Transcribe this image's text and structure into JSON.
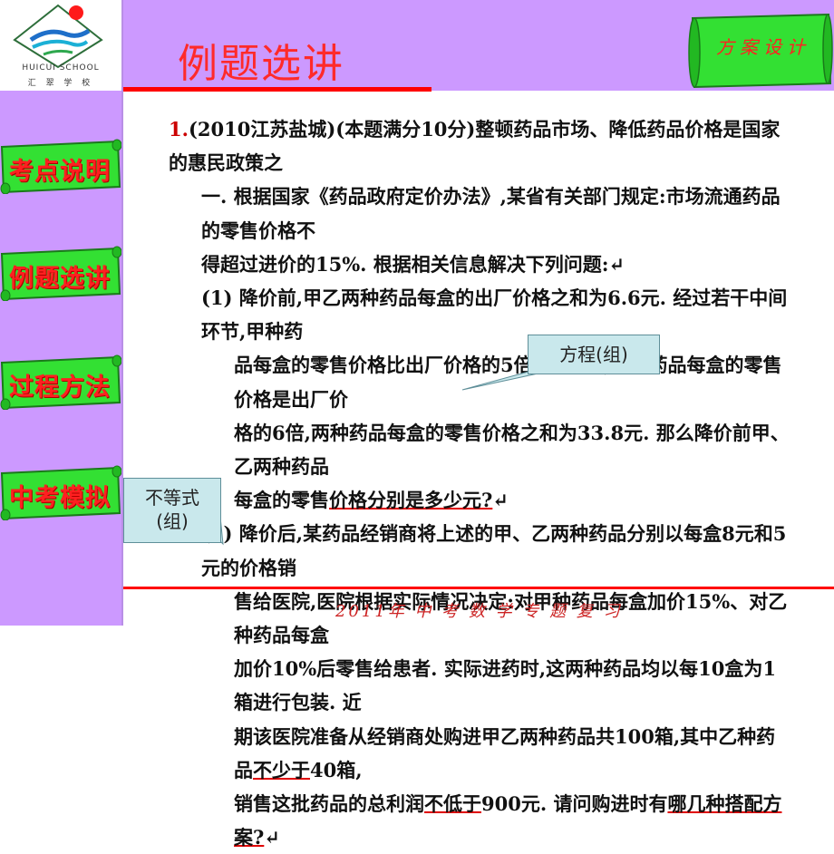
{
  "school": {
    "name_en": "HUICUI SCHOOL",
    "name_cn": "汇 翠 学 校"
  },
  "header": {
    "title": "例题选讲",
    "plan_label": "方案设计"
  },
  "sidebar": {
    "items": [
      {
        "label": "考点说明"
      },
      {
        "label": "例题选讲"
      },
      {
        "label": "过程方法"
      },
      {
        "label": "中考模拟"
      }
    ]
  },
  "problem": {
    "number": "1.",
    "intro_line1": "(2010江苏盐城)(本题满分10分)整顿药品市场、降低药品价格是国家的惠民政策之",
    "intro_line2": "一. 根据国家《药品政府定价办法》,某省有关部门规定:市场流通药品的零售价格不",
    "intro_line3": "得超过进价的15%. 根据相关信息解决下列问题:↵",
    "p1_line1": "(1) 降价前,甲乙两种药品每盒的出厂价格之和为6.6元. 经过若干中间环节,甲种药",
    "p1_line2": "品每盒的零售价格比出厂价格的5倍少2.2元,乙种药品每盒的零售价格是出厂价",
    "p1_line3": "格的6倍,两种药品每盒的零售价格之和为33.8元. 那么降价前甲、乙两种药品",
    "p1_line4_a": "每盒的零售",
    "p1_line4_u": "价格分别是多少元?",
    "p1_line4_b": "↵",
    "p2_line1": "(2) 降价后,某药品经销商将上述的甲、乙两种药品分别以每盒8元和5元的价格销",
    "p2_line2": "售给医院,医院根据实际情况决定:对甲种药品每盒加价15%、对乙种药品每盒",
    "p2_line3": "加价10%后零售给患者. 实际进药时,这两种药品均以每10盒为1箱进行包装. 近",
    "p2_line4_a": "期该医院准备从经销商处购进甲乙两种药品共100箱,其中乙种药品",
    "p2_line4_u": "不少于",
    "p2_line4_b": "40箱,",
    "p2_line5_a": "销售这批药品的总利润",
    "p2_line5_u1": "不低于",
    "p2_line5_b": "900元. 请问购进时有",
    "p2_line5_u2": "哪几种搭配方案?",
    "p2_line5_c": "↵"
  },
  "callouts": {
    "equation": "方程(组)",
    "inequality_line1": "不等式",
    "inequality_line2": "(组)"
  },
  "footer": {
    "text": "2011年 中 考 数 学 专 题 复 习"
  }
}
